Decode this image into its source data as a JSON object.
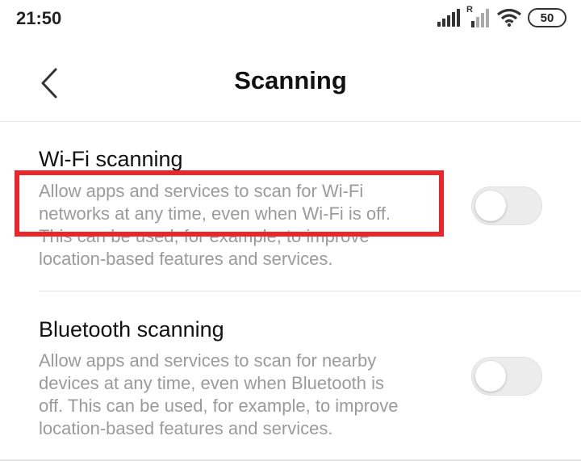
{
  "status_bar": {
    "time": "21:50",
    "network_label": "R",
    "battery_level": "50",
    "icons": [
      "signal-icon",
      "roaming-signal-icon",
      "wifi-icon",
      "battery-icon"
    ]
  },
  "header": {
    "title": "Scanning",
    "back_icon": "chevron-left-icon"
  },
  "settings": [
    {
      "title": "Wi-Fi scanning",
      "description_lines": [
        "Allow apps and services to scan for Wi-Fi",
        "networks at any time, even when Wi-Fi is off.",
        "This can be used, for example, to improve",
        "location-based features and services."
      ],
      "enabled": false
    },
    {
      "title": "Bluetooth scanning",
      "description_lines": [
        "Allow apps and services to scan for nearby",
        "devices at any time, even when Bluetooth is",
        "off. This can be used, for example, to improve",
        "location-based features and services."
      ],
      "enabled": false
    }
  ],
  "colors": {
    "highlight": "#e8262b",
    "description_text": "#9a9a9a",
    "toggle_off_track": "#ececec"
  }
}
